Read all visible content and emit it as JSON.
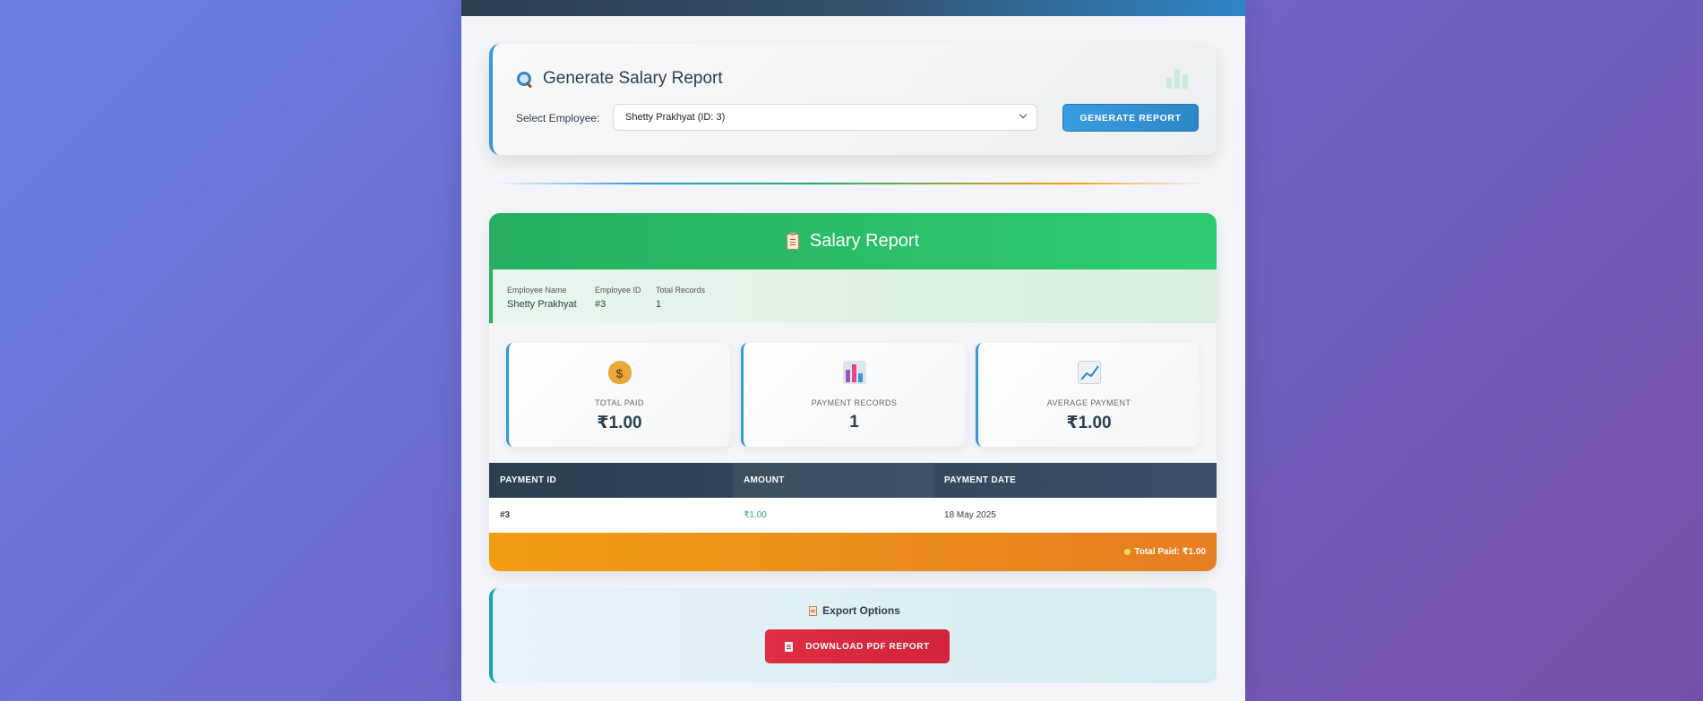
{
  "generate": {
    "title": "Generate Salary Report",
    "select_label": "Select Employee:",
    "selected_employee": "Shetty Prakhyat (ID: 3)",
    "button_label": "GENERATE REPORT"
  },
  "report": {
    "title": "Salary Report",
    "info": {
      "employee_name_label": "Employee Name",
      "employee_name": "Shetty Prakhyat",
      "employee_id_label": "Employee ID",
      "employee_id": "#3",
      "total_records_label": "Total Records",
      "total_records": "1"
    },
    "stats": [
      {
        "label": "TOTAL PAID",
        "value": "₹1.00",
        "icon": "money-bag-icon"
      },
      {
        "label": "PAYMENT RECORDS",
        "value": "1",
        "icon": "bar-chart-icon"
      },
      {
        "label": "AVERAGE PAYMENT",
        "value": "₹1.00",
        "icon": "trend-chart-icon"
      }
    ],
    "table": {
      "headers": [
        "PAYMENT ID",
        "AMOUNT",
        "PAYMENT DATE"
      ],
      "rows": [
        {
          "payment_id": "#3",
          "amount": "₹1.00",
          "payment_date": "18 May 2025"
        }
      ]
    },
    "total_paid_text": "Total Paid: ₹1.00"
  },
  "export": {
    "title": "Export Options",
    "pdf_button": "DOWNLOAD PDF REPORT"
  },
  "colors": {
    "primary_blue": "#3498db",
    "success_green": "#27ae60",
    "warning_orange": "#f39c12",
    "danger_red": "#dc3545",
    "dark_navy": "#2c3e50"
  }
}
